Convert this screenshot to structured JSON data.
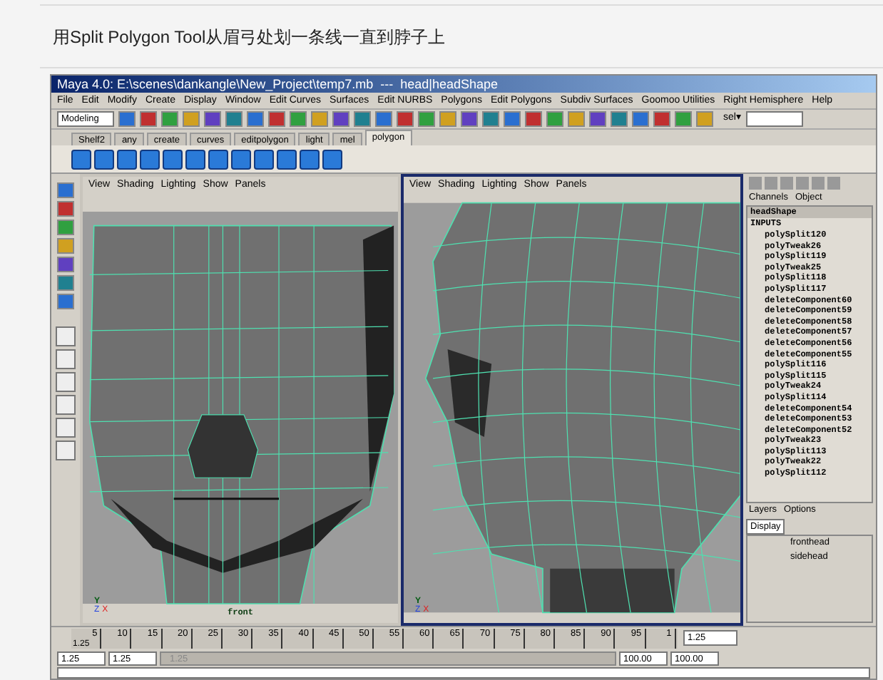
{
  "caption": "用Split Polygon Tool从眉弓处划一条线一直到脖子上",
  "window": {
    "title": "Maya 4.0: E:\\scenes\\dankangle\\New_Project\\temp7.mb  ---  head|headShape"
  },
  "menus": [
    "File",
    "Edit",
    "Modify",
    "Create",
    "Display",
    "Window",
    "Edit Curves",
    "Surfaces",
    "Edit NURBS",
    "Polygons",
    "Edit Polygons",
    "Subdiv Surfaces",
    "Goomoo Utilities",
    "Right Hemisphere",
    "Help"
  ],
  "toolbar": {
    "mode": "Modeling",
    "sel_label": "sel▾"
  },
  "shelf_tabs": [
    {
      "label": "Shelf2",
      "selected": false
    },
    {
      "label": "any",
      "selected": false
    },
    {
      "label": "create",
      "selected": false
    },
    {
      "label": "curves",
      "selected": false
    },
    {
      "label": "editpolygon",
      "selected": false
    },
    {
      "label": "light",
      "selected": false
    },
    {
      "label": "mel",
      "selected": false
    },
    {
      "label": "polygon",
      "selected": true
    }
  ],
  "viewports": [
    {
      "menus": [
        "View",
        "Shading",
        "Lighting",
        "Show",
        "Panels"
      ],
      "label": "front",
      "active": false,
      "axes": [
        "Y",
        "Z",
        "X"
      ]
    },
    {
      "menus": [
        "View",
        "Shading",
        "Lighting",
        "Show",
        "Panels"
      ],
      "active": true,
      "axes": [
        "Y",
        "Z",
        "X"
      ]
    }
  ],
  "channel_box": {
    "tabs": [
      "Channels",
      "Object"
    ],
    "node": "headShape",
    "section": "INPUTS",
    "inputs": [
      "polySplit120",
      "polyTweak26",
      "polySplit119",
      "polyTweak25",
      "polySplit118",
      "polySplit117",
      "deleteComponent60",
      "deleteComponent59",
      "deleteComponent58",
      "deleteComponent57",
      "deleteComponent56",
      "deleteComponent55",
      "polySplit116",
      "polySplit115",
      "polyTweak24",
      "polySplit114",
      "deleteComponent54",
      "deleteComponent53",
      "deleteComponent52",
      "polyTweak23",
      "polySplit113",
      "polyTweak22",
      "polySplit112"
    ]
  },
  "layers": {
    "menus": [
      "Layers",
      "Options"
    ],
    "display": "Display",
    "items": [
      "fronthead",
      "sidehead"
    ]
  },
  "timeline": {
    "ticks": [
      "5",
      "10",
      "15",
      "20",
      "25",
      "30",
      "35",
      "40",
      "45",
      "50",
      "55",
      "60",
      "65",
      "70",
      "75",
      "80",
      "85",
      "90",
      "95",
      "1"
    ],
    "start": "1.25",
    "current": "1.25"
  },
  "range": {
    "start": "1.25",
    "inner_start": "1.25",
    "bar_label": "1.25",
    "inner_end": "100.00",
    "end": "100.00"
  }
}
